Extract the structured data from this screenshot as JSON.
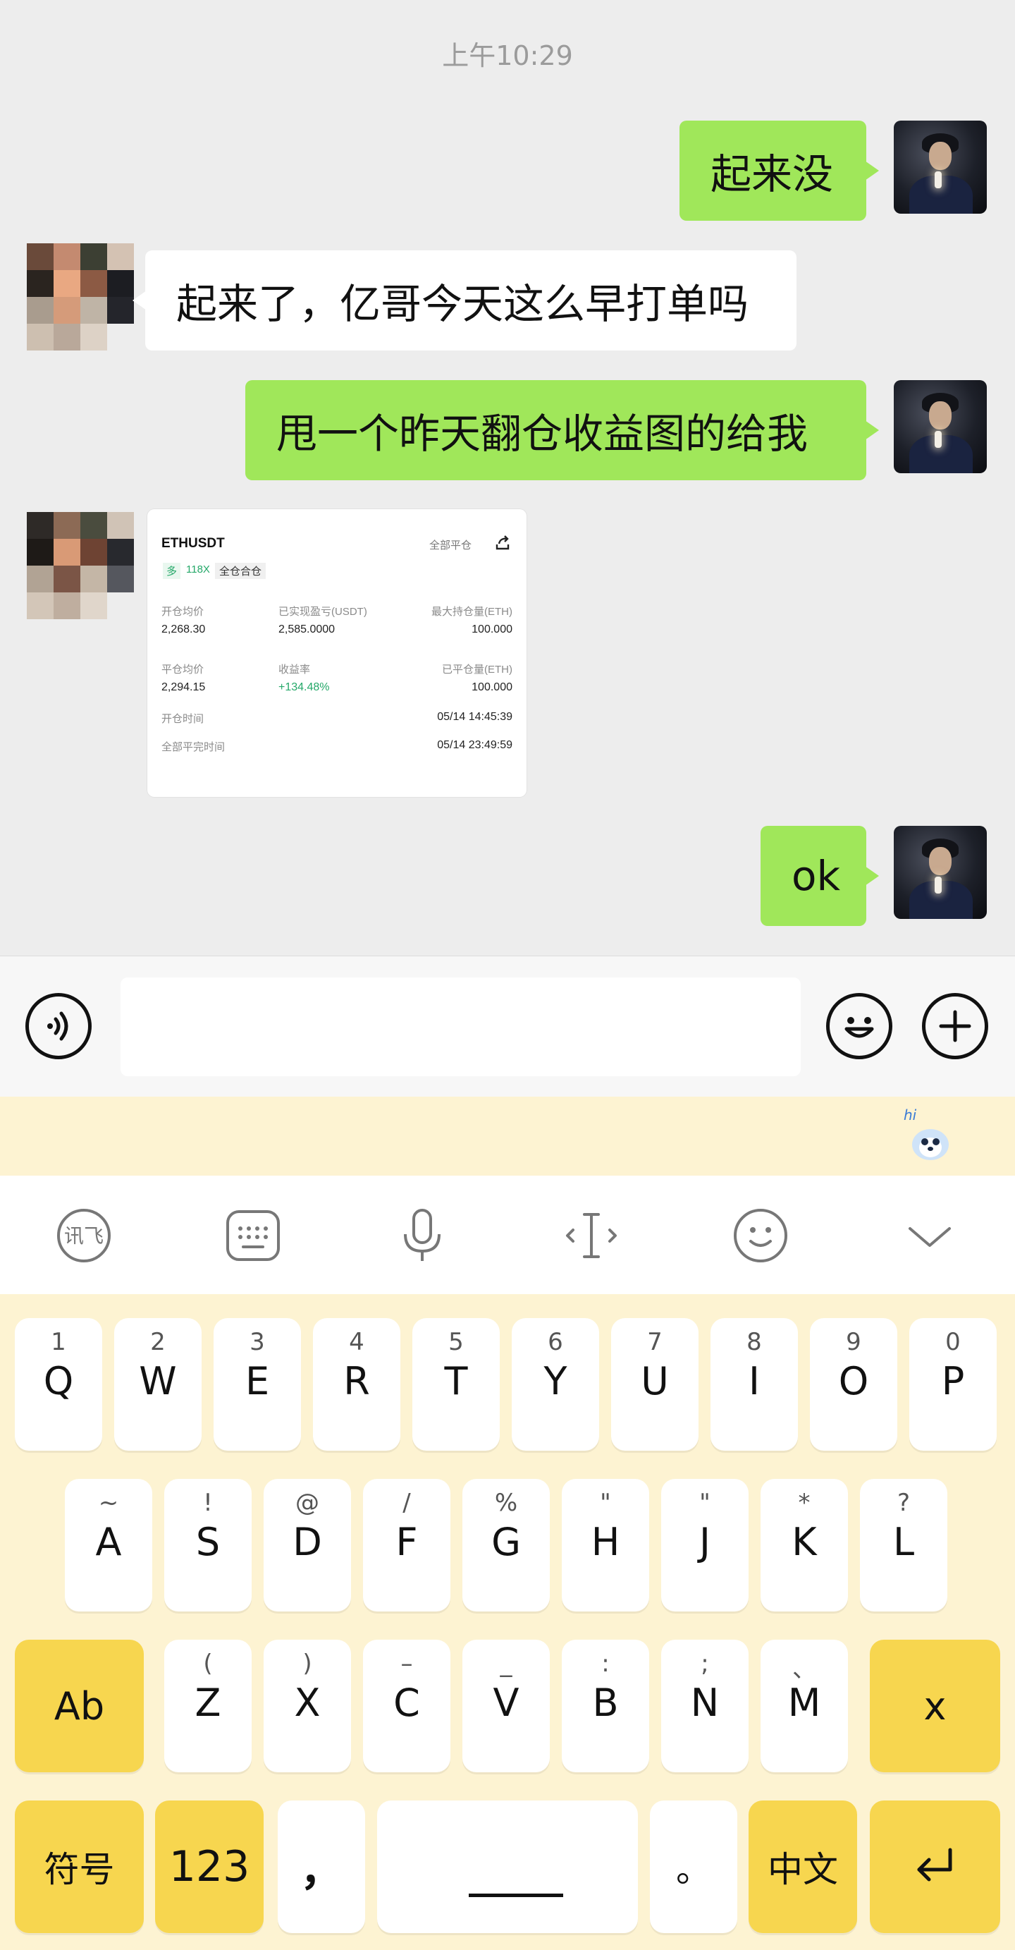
{
  "chat": {
    "timestamp": "上午10:29",
    "messages": [
      {
        "from": "me",
        "text": "起来没"
      },
      {
        "from": "other",
        "text": "起来了，亿哥今天这么早打单吗"
      },
      {
        "from": "me",
        "text": "甩一个昨天翻仓收益图的给我"
      },
      {
        "from": "other",
        "type": "image-card"
      },
      {
        "from": "me",
        "text": "ok"
      }
    ]
  },
  "trade_card": {
    "symbol": "ETHUSDT",
    "close_all": "全部平仓",
    "side": "多",
    "leverage": "118X",
    "margin_mode": "全仓合仓",
    "open_avg_label": "开仓均价",
    "open_avg_value": "2,268.30",
    "realized_pnl_label": "已实现盈亏(USDT)",
    "realized_pnl_value": "2,585.0000",
    "max_position_label": "最大持仓量(ETH)",
    "max_position_value": "100.000",
    "close_avg_label": "平仓均价",
    "close_avg_value": "2,294.15",
    "roi_label": "收益率",
    "roi_value": "+134.48%",
    "closed_qty_label": "已平仓量(ETH)",
    "closed_qty_value": "100.000",
    "open_time_label": "开仓时间",
    "open_time_value": "05/14 14:45:39",
    "close_time_label": "全部平完时间",
    "close_time_value": "05/14 23:49:59"
  },
  "input_bar": {
    "voice_icon": "voice-icon",
    "emoji_icon": "emoji-icon",
    "plus_icon": "plus-icon",
    "input_value": ""
  },
  "ime": {
    "mascot_text": "hi",
    "toolbar_icons": [
      "xunfei-logo-icon",
      "keyboard-icon",
      "microphone-icon",
      "text-cursor-icon",
      "emoji-icon",
      "chevron-down-icon"
    ],
    "row1": [
      {
        "sub": "1",
        "main": "Q"
      },
      {
        "sub": "2",
        "main": "W"
      },
      {
        "sub": "3",
        "main": "E"
      },
      {
        "sub": "4",
        "main": "R"
      },
      {
        "sub": "5",
        "main": "T"
      },
      {
        "sub": "6",
        "main": "Y"
      },
      {
        "sub": "7",
        "main": "U"
      },
      {
        "sub": "8",
        "main": "I"
      },
      {
        "sub": "9",
        "main": "O"
      },
      {
        "sub": "0",
        "main": "P"
      }
    ],
    "row2": [
      {
        "sub": "~",
        "main": "A"
      },
      {
        "sub": "!",
        "main": "S"
      },
      {
        "sub": "@",
        "main": "D"
      },
      {
        "sub": "/",
        "main": "F"
      },
      {
        "sub": "%",
        "main": "G"
      },
      {
        "sub": "\"",
        "main": "H"
      },
      {
        "sub": "\"",
        "main": "J"
      },
      {
        "sub": "*",
        "main": "K"
      },
      {
        "sub": "?",
        "main": "L"
      }
    ],
    "row3_shift": "Ab",
    "row3": [
      {
        "sub": "(",
        "main": "Z"
      },
      {
        "sub": ")",
        "main": "X"
      },
      {
        "sub": "–",
        "main": "C"
      },
      {
        "sub": "_",
        "main": "V"
      },
      {
        "sub": ":",
        "main": "B"
      },
      {
        "sub": ";",
        "main": "N"
      },
      {
        "sub": "、",
        "main": "M"
      }
    ],
    "row3_delete": "x",
    "row4": {
      "symbols": "符号",
      "numbers": "123",
      "comma": "，",
      "space": "",
      "period": "。",
      "lang": "中文",
      "enter_icon": "return-arrow-icon"
    }
  },
  "colors": {
    "chat_bg": "#ededed",
    "my_bubble": "#a0e75a",
    "other_bubble": "#ffffff",
    "keyboard_bg": "#fdf3d2",
    "accent_key": "#f7d64f",
    "profit_green": "#25a869"
  }
}
